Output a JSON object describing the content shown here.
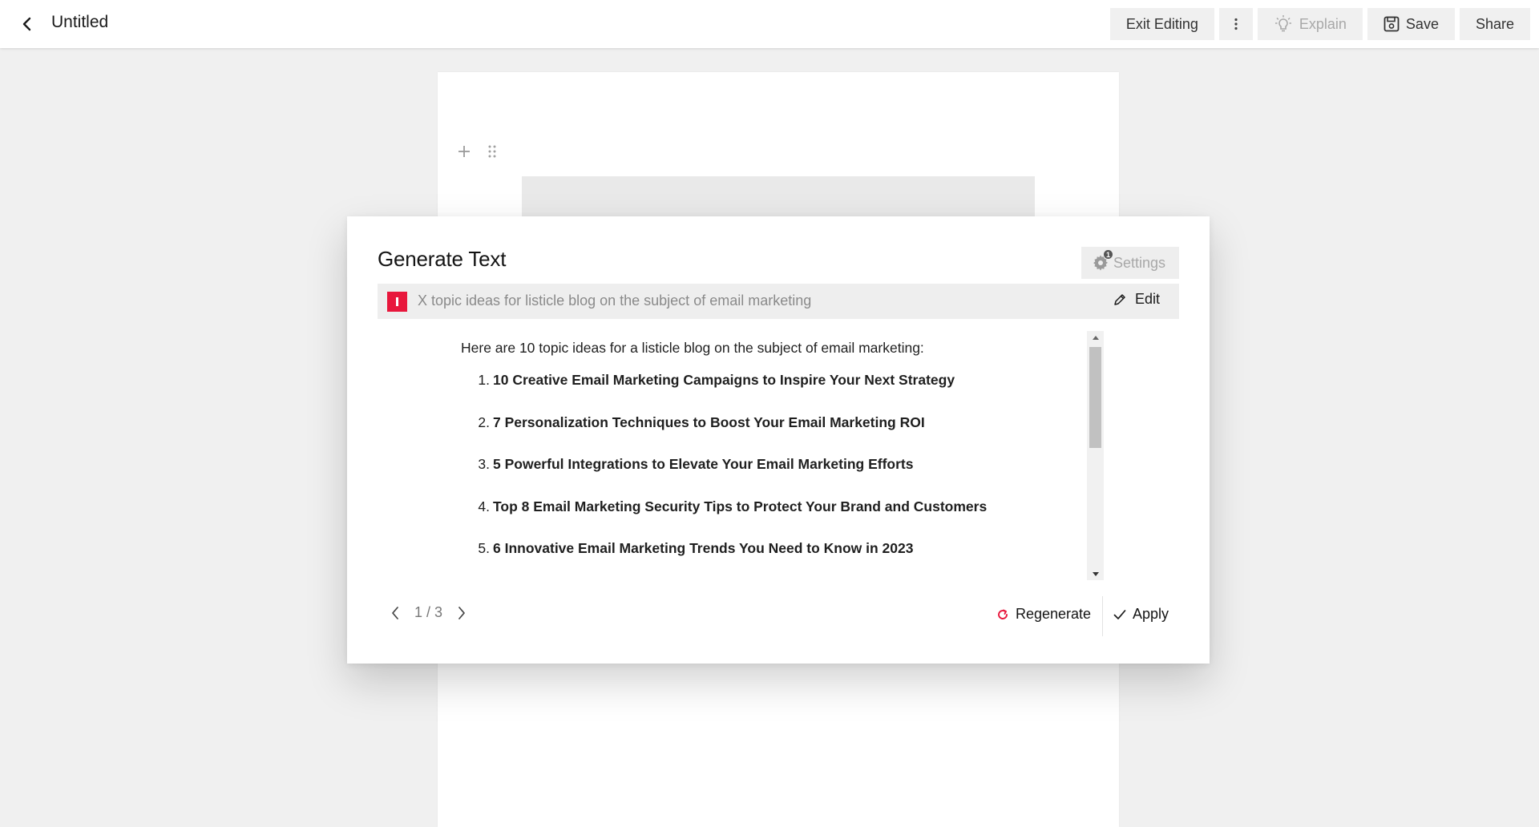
{
  "header": {
    "doc_title": "Untitled",
    "actions": {
      "exit_editing": "Exit Editing",
      "explain": "Explain",
      "save": "Save",
      "share": "Share"
    }
  },
  "generate_panel": {
    "title": "Generate Text",
    "settings_label": "Settings",
    "settings_badge": "1",
    "prompt": "X topic ideas for listicle blog on the subject of email marketing",
    "edit_label": "Edit",
    "result": {
      "intro": "Here are 10 topic ideas for a listicle blog on the subject of email marketing:",
      "items": [
        {
          "num": "1.",
          "text": "10 Creative Email Marketing Campaigns to Inspire Your Next Strategy"
        },
        {
          "num": "2.",
          "text": "7 Personalization Techniques to Boost Your Email Marketing ROI"
        },
        {
          "num": "3.",
          "text": "5 Powerful Integrations to Elevate Your Email Marketing Efforts"
        },
        {
          "num": "4.",
          "text": "Top 8 Email Marketing Security Tips to Protect Your Brand and Customers"
        },
        {
          "num": "5.",
          "text": "6 Innovative Email Marketing Trends You Need to Know in 2023"
        }
      ]
    },
    "pager": "1 / 3",
    "regenerate_label": "Regenerate",
    "apply_label": "Apply"
  },
  "colors": {
    "accent_red": "#e8173c",
    "page_bg": "#f0f0f0",
    "button_bg": "#f0f0f0"
  }
}
